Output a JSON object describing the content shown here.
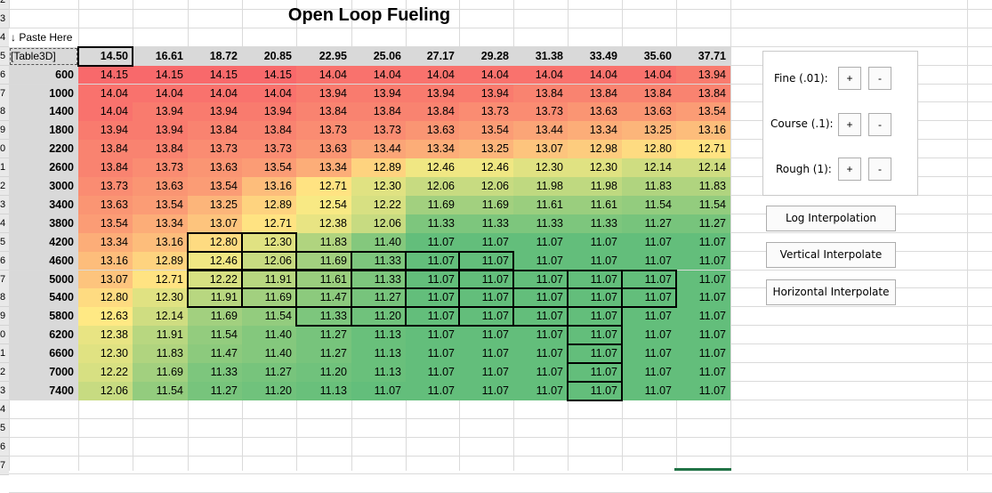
{
  "title": "Open Loop Fueling",
  "corner": {
    "paste_label": "↓ Paste Here",
    "table_label": "[Table3D]"
  },
  "row_numbers": [
    "2",
    "3",
    "4",
    "5",
    "6",
    "7",
    "8",
    "9",
    "0",
    "1",
    "2",
    "3",
    "4",
    "5",
    "6",
    "7",
    "8",
    "9",
    "0",
    "1",
    "2",
    "3",
    "4",
    "5",
    "6",
    "7"
  ],
  "columns": [
    "14.50",
    "16.61",
    "18.72",
    "20.85",
    "22.95",
    "25.06",
    "27.17",
    "29.28",
    "31.38",
    "33.49",
    "35.60",
    "37.71"
  ],
  "rows": [
    {
      "rpm": "600",
      "values": [
        "14.15",
        "14.15",
        "14.15",
        "14.15",
        "14.04",
        "14.04",
        "14.04",
        "14.04",
        "14.04",
        "14.04",
        "14.04",
        "13.94"
      ]
    },
    {
      "rpm": "1000",
      "values": [
        "14.04",
        "14.04",
        "14.04",
        "14.04",
        "13.94",
        "13.94",
        "13.94",
        "13.94",
        "13.84",
        "13.84",
        "13.84",
        "13.84"
      ]
    },
    {
      "rpm": "1400",
      "values": [
        "14.04",
        "13.94",
        "13.94",
        "13.94",
        "13.84",
        "13.84",
        "13.84",
        "13.73",
        "13.73",
        "13.63",
        "13.63",
        "13.54"
      ]
    },
    {
      "rpm": "1800",
      "values": [
        "13.94",
        "13.94",
        "13.84",
        "13.84",
        "13.73",
        "13.73",
        "13.63",
        "13.54",
        "13.44",
        "13.34",
        "13.25",
        "13.16"
      ]
    },
    {
      "rpm": "2200",
      "values": [
        "13.84",
        "13.84",
        "13.73",
        "13.73",
        "13.63",
        "13.44",
        "13.34",
        "13.25",
        "13.07",
        "12.98",
        "12.80",
        "12.71"
      ]
    },
    {
      "rpm": "2600",
      "values": [
        "13.84",
        "13.73",
        "13.63",
        "13.54",
        "13.34",
        "12.89",
        "12.46",
        "12.46",
        "12.30",
        "12.30",
        "12.14",
        "12.14"
      ]
    },
    {
      "rpm": "3000",
      "values": [
        "13.73",
        "13.63",
        "13.54",
        "13.16",
        "12.71",
        "12.30",
        "12.06",
        "12.06",
        "11.98",
        "11.98",
        "11.83",
        "11.83"
      ]
    },
    {
      "rpm": "3400",
      "values": [
        "13.63",
        "13.54",
        "13.25",
        "12.89",
        "12.54",
        "12.22",
        "11.69",
        "11.69",
        "11.61",
        "11.61",
        "11.54",
        "11.54"
      ]
    },
    {
      "rpm": "3800",
      "values": [
        "13.54",
        "13.34",
        "13.07",
        "12.71",
        "12.38",
        "12.06",
        "11.33",
        "11.33",
        "11.33",
        "11.33",
        "11.27",
        "11.27"
      ]
    },
    {
      "rpm": "4200",
      "values": [
        "13.34",
        "13.16",
        "12.80",
        "12.30",
        "11.83",
        "11.40",
        "11.07",
        "11.07",
        "11.07",
        "11.07",
        "11.07",
        "11.07"
      ]
    },
    {
      "rpm": "4600",
      "values": [
        "13.16",
        "12.89",
        "12.46",
        "12.06",
        "11.69",
        "11.33",
        "11.07",
        "11.07",
        "11.07",
        "11.07",
        "11.07",
        "11.07"
      ]
    },
    {
      "rpm": "5000",
      "values": [
        "13.07",
        "12.71",
        "12.22",
        "11.91",
        "11.61",
        "11.33",
        "11.07",
        "11.07",
        "11.07",
        "11.07",
        "11.07",
        "11.07"
      ]
    },
    {
      "rpm": "5400",
      "values": [
        "12.80",
        "12.30",
        "11.91",
        "11.69",
        "11.47",
        "11.27",
        "11.07",
        "11.07",
        "11.07",
        "11.07",
        "11.07",
        "11.07"
      ]
    },
    {
      "rpm": "5800",
      "values": [
        "12.63",
        "12.14",
        "11.69",
        "11.54",
        "11.33",
        "11.20",
        "11.07",
        "11.07",
        "11.07",
        "11.07",
        "11.07",
        "11.07"
      ]
    },
    {
      "rpm": "6200",
      "values": [
        "12.38",
        "11.91",
        "11.54",
        "11.40",
        "11.27",
        "11.13",
        "11.07",
        "11.07",
        "11.07",
        "11.07",
        "11.07",
        "11.07"
      ]
    },
    {
      "rpm": "6600",
      "values": [
        "12.30",
        "11.83",
        "11.47",
        "11.40",
        "11.27",
        "11.13",
        "11.07",
        "11.07",
        "11.07",
        "11.07",
        "11.07",
        "11.07"
      ]
    },
    {
      "rpm": "7000",
      "values": [
        "12.22",
        "11.69",
        "11.33",
        "11.27",
        "11.20",
        "11.13",
        "11.07",
        "11.07",
        "11.07",
        "11.07",
        "11.07",
        "11.07"
      ]
    },
    {
      "rpm": "7400",
      "values": [
        "12.06",
        "11.54",
        "11.27",
        "11.20",
        "11.13",
        "11.07",
        "11.07",
        "11.07",
        "11.07",
        "11.07",
        "11.07",
        "11.07"
      ]
    }
  ],
  "colors": {
    "high": "#f8696b",
    "mid": "#ffeb84",
    "low": "#63be7b",
    "header_bg": "#d9d9d9"
  },
  "controls": {
    "fine_label": "Fine (.01):",
    "course_label": "Course (.1):",
    "rough_label": "Rough (1):",
    "plus": "+",
    "minus": "-",
    "log_interpolation": "Log Interpolation",
    "vertical_interpolate": "Vertical Interpolate",
    "horizontal_interpolate": "Horizontal Interpolate"
  },
  "selected_cells": [
    [
      9,
      2
    ],
    [
      9,
      3
    ],
    [
      10,
      2
    ],
    [
      10,
      3
    ],
    [
      11,
      2
    ],
    [
      11,
      3
    ],
    [
      12,
      2
    ],
    [
      12,
      3
    ],
    [
      10,
      4
    ],
    [
      10,
      5
    ],
    [
      10,
      6
    ],
    [
      10,
      7
    ],
    [
      11,
      4
    ],
    [
      11,
      5
    ],
    [
      11,
      6
    ],
    [
      11,
      7
    ],
    [
      11,
      8
    ],
    [
      11,
      9
    ],
    [
      11,
      10
    ],
    [
      12,
      4
    ],
    [
      12,
      5
    ],
    [
      12,
      6
    ],
    [
      12,
      7
    ],
    [
      12,
      8
    ],
    [
      12,
      9
    ],
    [
      12,
      10
    ],
    [
      13,
      4
    ],
    [
      13,
      5
    ],
    [
      13,
      6
    ],
    [
      13,
      7
    ],
    [
      13,
      8
    ],
    [
      13,
      9
    ],
    [
      14,
      9
    ],
    [
      15,
      9
    ],
    [
      16,
      9
    ],
    [
      17,
      9
    ],
    [
      -1,
      0
    ]
  ]
}
